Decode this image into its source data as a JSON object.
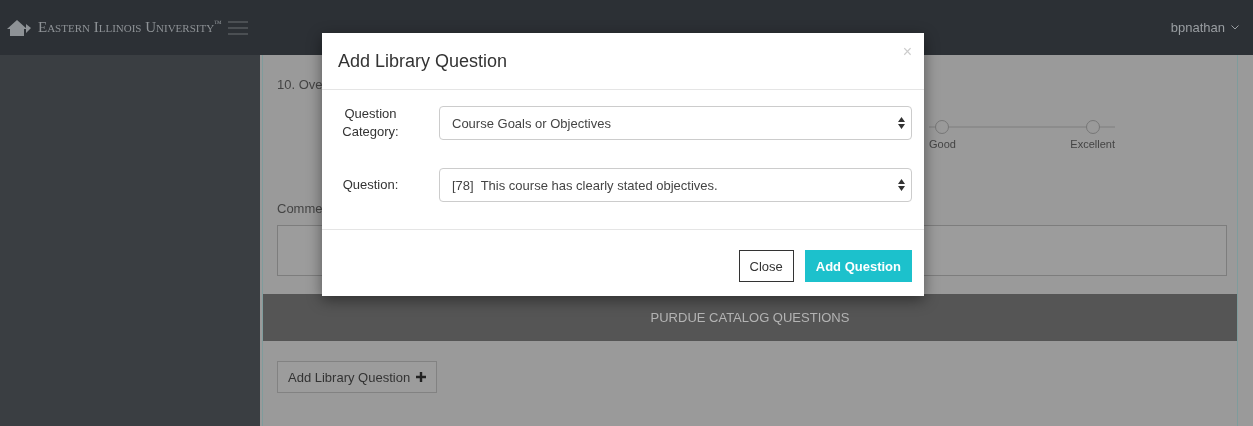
{
  "topbar": {
    "brand": "Eastern Illinois University",
    "trademark": "™",
    "user": "bpnathan"
  },
  "form": {
    "question_label": "10. Ove",
    "rating_options": [
      {
        "label": "Good",
        "selected": false
      },
      {
        "label": "Excellent",
        "selected": false
      }
    ],
    "comments_label": "Comme",
    "section_header": "PURDUE CATALOG QUESTIONS",
    "add_button": "Add Library Question"
  },
  "modal": {
    "title": "Add Library Question",
    "close": "×",
    "fields": [
      {
        "label": "Question Category:",
        "value": "Course Goals or Objectives"
      },
      {
        "label": "Question:",
        "value": "[78]  This course has clearly stated objectives."
      }
    ],
    "buttons": [
      {
        "label": "Close",
        "kind": "default"
      },
      {
        "label": "Add Question",
        "kind": "primary"
      }
    ]
  }
}
